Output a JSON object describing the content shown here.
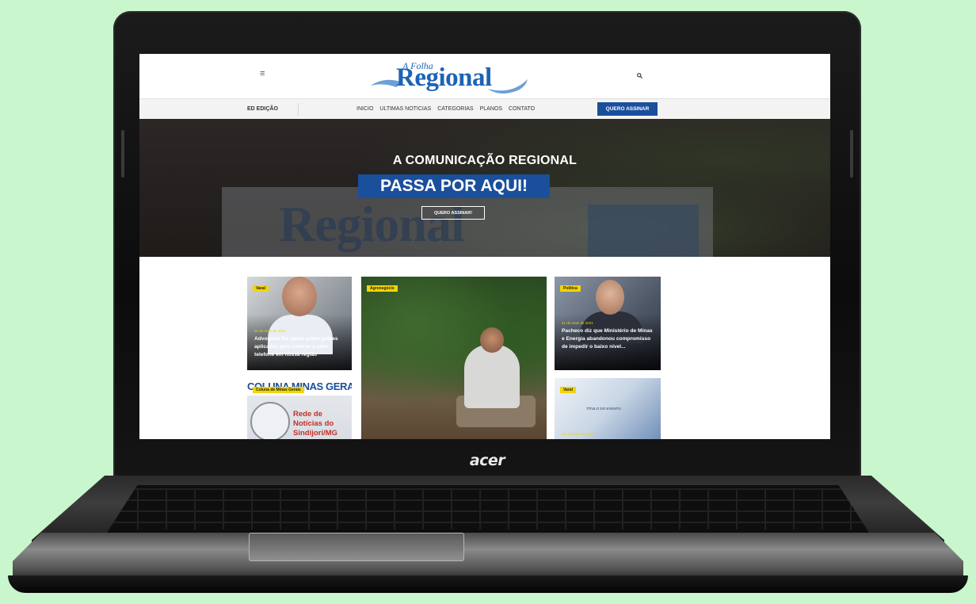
{
  "laptop": {
    "brand": "acer"
  },
  "site": {
    "logo": {
      "small": "A Folha",
      "main": "Regional"
    },
    "menu_icon": "hamburger-menu-icon",
    "search_icon": "search-icon",
    "nav": {
      "edition": "ED EDIÇÃO",
      "links": [
        "INICIO",
        "ULTIMAS NOTICIAS",
        "CATEGORIAS",
        "PLANOS",
        "CONTATO"
      ],
      "subscribe": "QUERO ASSINAR"
    },
    "hero": {
      "title": "A COMUNICAÇÃO REGIONAL",
      "highlight": "PASSA POR AQUI!",
      "button": "QUERO ASSINAR!"
    },
    "cards": [
      {
        "tag": "Varal",
        "date": "21 de maio de 2021",
        "title": "Advogado faz alerta sobre golpes aplicados pela internet e pelo telefone em nossa região"
      },
      {
        "tag": "Agronegócio",
        "date": "",
        "title": ""
      },
      {
        "tag": "Politica",
        "date": "21 de maio de 2021",
        "title": "Pacheco diz que Ministério de Minas e Energia abandonou compromisso de impedir o baixo nível..."
      },
      {
        "tag": "Coluna de Minas Gerais",
        "banner": "COLUNA MINAS GERAIS",
        "extra": "Rede de Notícias do Sindijori/MG"
      },
      {
        "tag": "Varal",
        "date": "21 de maio de 2021",
        "extra": "TÍTULO DO EVENTO"
      }
    ]
  },
  "colors": {
    "background": "#c9f6cc",
    "brand_blue": "#1a4f9c",
    "tag_yellow": "#f3d500"
  }
}
